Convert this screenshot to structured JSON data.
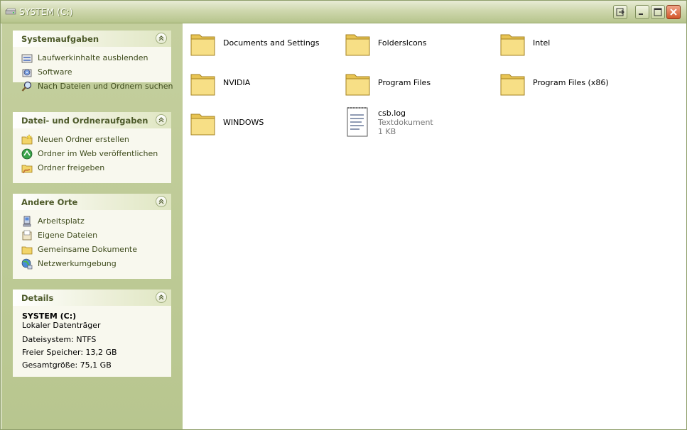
{
  "window": {
    "title": "SYSTEM (C:)"
  },
  "sidebar": {
    "system_tasks": {
      "title": "Systemaufgaben",
      "items": [
        {
          "label": "Laufwerkinhalte ausblenden",
          "icon": "hide-drive-contents-icon"
        },
        {
          "label": "Software",
          "icon": "software-icon"
        },
        {
          "label": "Nach Dateien und Ordnern suchen",
          "icon": "search-icon"
        }
      ]
    },
    "file_tasks": {
      "title": "Datei- und Ordneraufgaben",
      "items": [
        {
          "label": "Neuen Ordner erstellen",
          "icon": "new-folder-icon"
        },
        {
          "label": "Ordner im Web veröffentlichen",
          "icon": "publish-web-icon"
        },
        {
          "label": "Ordner freigeben",
          "icon": "share-folder-icon"
        }
      ]
    },
    "other_places": {
      "title": "Andere Orte",
      "items": [
        {
          "label": "Arbeitsplatz",
          "icon": "my-computer-icon"
        },
        {
          "label": "Eigene Dateien",
          "icon": "my-documents-icon"
        },
        {
          "label": "Gemeinsame Dokumente",
          "icon": "shared-documents-icon"
        },
        {
          "label": "Netzwerkumgebung",
          "icon": "network-icon"
        }
      ]
    },
    "details": {
      "title": "Details",
      "name": "SYSTEM (C:)",
      "type": "Lokaler Datenträger",
      "filesystem": "Dateisystem: NTFS",
      "free": "Freier Speicher: 13,2 GB",
      "total": "Gesamtgröße: 75,1 GB"
    }
  },
  "files": [
    {
      "name": "Documents and Settings",
      "kind": "folder"
    },
    {
      "name": "FoldersIcons",
      "kind": "folder"
    },
    {
      "name": "Intel",
      "kind": "folder"
    },
    {
      "name": "NVIDIA",
      "kind": "folder"
    },
    {
      "name": "Program Files",
      "kind": "folder"
    },
    {
      "name": "Program Files (x86)",
      "kind": "folder"
    },
    {
      "name": "WINDOWS",
      "kind": "folder"
    },
    {
      "name": "csb.log",
      "kind": "file",
      "type": "Textdokument",
      "size": "1 KB"
    }
  ],
  "colors": {
    "accent": "#4d5a2a",
    "sidebar": "#c4cf9e",
    "folder": "#f5dc7a"
  }
}
